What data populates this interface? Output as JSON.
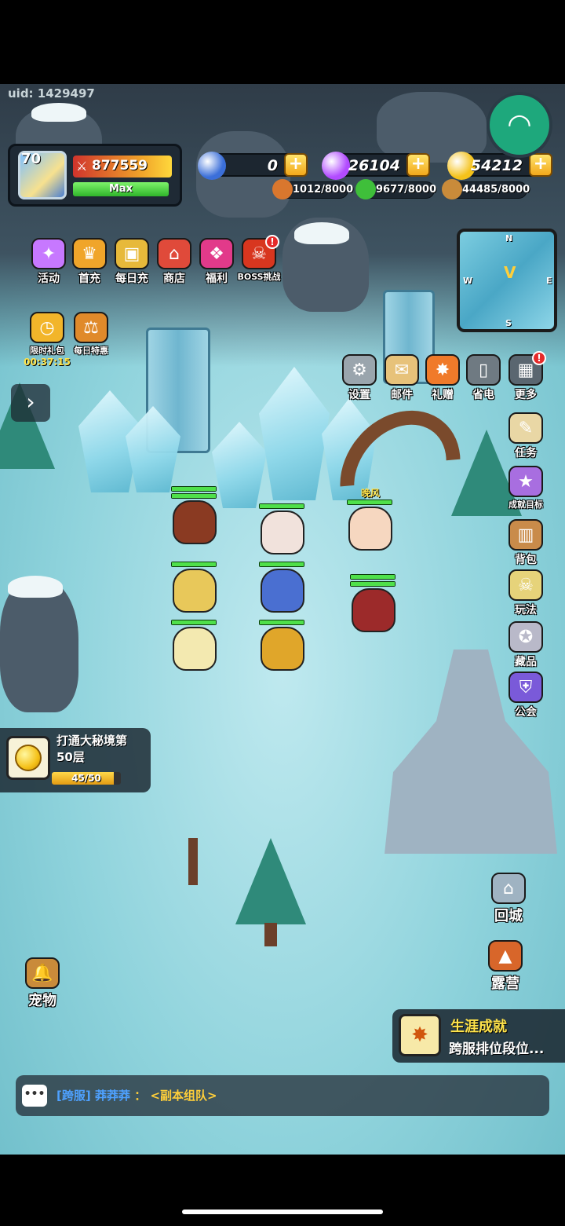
{
  "uid": "uid: 1429497",
  "player": {
    "level": "70",
    "power": "877559",
    "exp_label": "Max",
    "exp_fill": 1.0
  },
  "currencies": [
    {
      "name": "moon",
      "value": "0",
      "color": "#3b6fd9"
    },
    {
      "name": "gem",
      "value": "26104",
      "color": "#b24bff"
    },
    {
      "name": "gold",
      "value": "54212",
      "color": "#f5c21a"
    }
  ],
  "resources": [
    {
      "name": "meat",
      "value": "1012/8000",
      "color": "#d9772e"
    },
    {
      "name": "herb",
      "value": "9677/8000",
      "color": "#3fbf3a"
    },
    {
      "name": "ore",
      "value": "44485/8000",
      "color": "#c98b3a"
    }
  ],
  "top_menu": [
    {
      "label": "活动",
      "icon": "gift-box-icon",
      "color": "#c778ff"
    },
    {
      "label": "首充",
      "icon": "crown-icon",
      "color": "#f0a52a"
    },
    {
      "label": "每日充",
      "icon": "treasure-chest-icon",
      "color": "#e7b93a"
    },
    {
      "label": "商店",
      "icon": "shop-icon",
      "color": "#e04a3a"
    },
    {
      "label": "福利",
      "icon": "present-icon",
      "color": "#e23a8a"
    },
    {
      "label": "BOSS挑战",
      "icon": "boss-icon",
      "color": "#d8361f",
      "badge": "!"
    }
  ],
  "second_menu": [
    {
      "label": "限时礼包",
      "timer": "00:37:15",
      "icon": "stopwatch-icon",
      "color": "#f2b52a"
    },
    {
      "label": "每日特惠",
      "icon": "scale-icon",
      "color": "#e08a2a"
    }
  ],
  "tools_menu": [
    {
      "label": "设置",
      "icon": "gear-icon",
      "color": "#9aa5ad"
    },
    {
      "label": "邮件",
      "icon": "mail-icon",
      "color": "#e7c27a"
    },
    {
      "label": "礼赠",
      "icon": "gift-icon",
      "color": "#f07a2a"
    },
    {
      "label": "省电",
      "icon": "battery-icon",
      "color": "#6f7a82"
    },
    {
      "label": "更多",
      "icon": "grid-icon",
      "color": "#5a6670",
      "badge": "!"
    }
  ],
  "side_menu": [
    {
      "label": "任务",
      "icon": "scroll-icon",
      "color": "#e9d7a5"
    },
    {
      "label": "成就目标",
      "icon": "trophy-badge-icon",
      "color": "#a86ee0"
    },
    {
      "label": "背包",
      "icon": "backpack-icon",
      "color": "#c98b4a"
    },
    {
      "label": "玩法",
      "icon": "skull-icon",
      "color": "#e6d37a"
    },
    {
      "label": "藏品",
      "icon": "star-trophy-icon",
      "color": "#b9b9c9"
    },
    {
      "label": "公会",
      "icon": "shield-icon",
      "color": "#7a5ad9"
    }
  ],
  "bottom_right": [
    {
      "label": "回城",
      "icon": "portal-icon",
      "color": "#9fb3c2"
    },
    {
      "label": "露营",
      "icon": "camp-icon",
      "color": "#d8662a"
    }
  ],
  "pet": {
    "label": "宠物",
    "icon": "pet-bell-icon",
    "color": "#c98b3a"
  },
  "minimap": {
    "n": "N",
    "s": "S",
    "w": "W",
    "e": "E"
  },
  "hero_name": "晚风",
  "quest": {
    "line1": "打通大秘境第",
    "line2": "50层",
    "progress_text": "45/50",
    "progress": 0.9
  },
  "achievement": {
    "title": "生涯成就",
    "subtitle": "跨服排位段位..."
  },
  "chat": {
    "tag": "[跨服]",
    "user": "莽莽莽",
    "sep": "：",
    "message": "<副本组队>"
  }
}
